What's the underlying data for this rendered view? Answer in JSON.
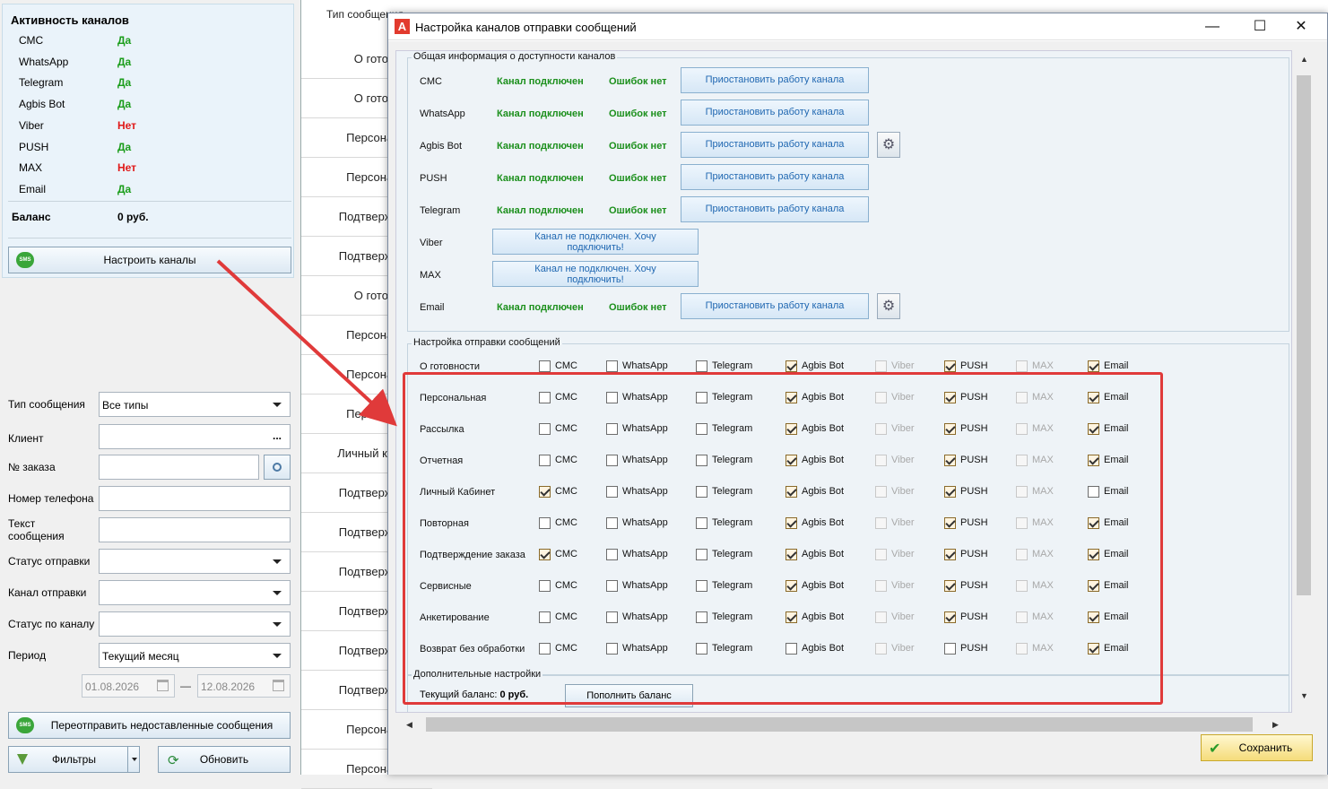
{
  "activity": {
    "title": "Активность каналов",
    "channels": [
      {
        "name": "СМС",
        "value": "Да",
        "status": "yes"
      },
      {
        "name": "WhatsApp",
        "value": "Да",
        "status": "yes"
      },
      {
        "name": "Telegram",
        "value": "Да",
        "status": "yes"
      },
      {
        "name": "Agbis Bot",
        "value": "Да",
        "status": "yes"
      },
      {
        "name": "Viber",
        "value": "Нет",
        "status": "no"
      },
      {
        "name": "PUSH",
        "value": "Да",
        "status": "yes"
      },
      {
        "name": "MAX",
        "value": "Нет",
        "status": "no"
      },
      {
        "name": "Email",
        "value": "Да",
        "status": "yes"
      }
    ],
    "balance_label": "Баланс",
    "balance_value": "0 руб.",
    "configure_button": "Настроить каналы",
    "sms_icon_text": "SMS"
  },
  "filters": {
    "message_type_label": "Тип сообщения",
    "message_type_value": "Все типы",
    "client_label": "Клиент",
    "client_dots": "...",
    "order_label": "№ заказа",
    "phone_label": "Номер телефона",
    "text_label_1": "Текст",
    "text_label_2": "сообщения",
    "send_status_label": "Статус отправки",
    "channel_label": "Канал отправки",
    "channel_status_label": "Статус по каналу",
    "period_label": "Период",
    "period_value": "Текущий месяц",
    "date_from": "01.08.2026",
    "date_dash": "—",
    "date_to": "12.08.2026",
    "resend_button": "Переотправить недоставленные сообщения",
    "filters_button": "Фильтры",
    "refresh_button": "Обновить"
  },
  "grid": {
    "header": "Тип сообщения",
    "rows": [
      "О готовности",
      "О готовности",
      "Персональная",
      "Персональная",
      "Подтверждение",
      "Подтверждение",
      "О готовности",
      "Персональная",
      "Персональная",
      "Персональная",
      "Личный кабинет",
      "Подтверждение",
      "Подтверждение",
      "Подтверждение",
      "Подтверждение",
      "Подтверждение",
      "Подтверждение",
      "Персональная",
      "Персональная"
    ]
  },
  "dialog": {
    "app_icon": "A",
    "title": "Настройка каналов отправки сообщений",
    "minimize": "—",
    "maximize": "☐",
    "close": "✕",
    "availability": {
      "title": "Общая информация о доступности каналов",
      "rows": [
        {
          "name": "СМС",
          "connected": true,
          "status": "Канал подключен",
          "errors": "Ошибок нет",
          "button": "Приостановить работу канала",
          "gear": false
        },
        {
          "name": "WhatsApp",
          "connected": true,
          "status": "Канал подключен",
          "errors": "Ошибок нет",
          "button": "Приостановить работу канала",
          "gear": false
        },
        {
          "name": "Agbis Bot",
          "connected": true,
          "status": "Канал подключен",
          "errors": "Ошибок нет",
          "button": "Приостановить работу канала",
          "gear": true
        },
        {
          "name": "PUSH",
          "connected": true,
          "status": "Канал подключен",
          "errors": "Ошибок нет",
          "button": "Приостановить работу канала",
          "gear": false
        },
        {
          "name": "Telegram",
          "connected": true,
          "status": "Канал подключен",
          "errors": "Ошибок нет",
          "button": "Приостановить работу канала",
          "gear": false
        },
        {
          "name": "Viber",
          "connected": false,
          "button1": "Канал не подключен. Хочу",
          "button2": "подключить!",
          "gear": false
        },
        {
          "name": "MAX",
          "connected": false,
          "button1": "Канал не подключен. Хочу",
          "button2": "подключить!",
          "gear": false
        },
        {
          "name": "Email",
          "connected": true,
          "status": "Канал подключен",
          "errors": "Ошибок нет",
          "button": "Приостановить работу канала",
          "gear": true
        }
      ]
    },
    "sending": {
      "title": "Настройка отправки сообщений",
      "channels": [
        "СМС",
        "WhatsApp",
        "Telegram",
        "Agbis Bot",
        "Viber",
        "PUSH",
        "MAX",
        "Email"
      ],
      "disabled_channels": [
        "Viber",
        "MAX"
      ],
      "rows": [
        {
          "type": "О готовности",
          "checked": [
            false,
            false,
            false,
            true,
            false,
            true,
            false,
            true
          ]
        },
        {
          "type": "Персональная",
          "checked": [
            false,
            false,
            false,
            true,
            false,
            true,
            false,
            true
          ]
        },
        {
          "type": "Рассылка",
          "checked": [
            false,
            false,
            false,
            true,
            false,
            true,
            false,
            true
          ]
        },
        {
          "type": "Отчетная",
          "checked": [
            false,
            false,
            false,
            true,
            false,
            true,
            false,
            true
          ]
        },
        {
          "type": "Личный Кабинет",
          "checked": [
            true,
            false,
            false,
            true,
            false,
            true,
            false,
            false
          ]
        },
        {
          "type": "Повторная",
          "checked": [
            false,
            false,
            false,
            true,
            false,
            true,
            false,
            true
          ]
        },
        {
          "type": "Подтверждение заказа",
          "checked": [
            true,
            false,
            false,
            true,
            false,
            true,
            false,
            true
          ]
        },
        {
          "type": "Сервисные",
          "checked": [
            false,
            false,
            false,
            true,
            false,
            true,
            false,
            true
          ]
        },
        {
          "type": "Анкетирование",
          "checked": [
            false,
            false,
            false,
            true,
            false,
            true,
            false,
            true
          ]
        },
        {
          "type": "Возврат без обработки",
          "checked": [
            false,
            false,
            false,
            false,
            false,
            false,
            false,
            true
          ]
        }
      ]
    },
    "extra": {
      "title": "Дополнительные настройки",
      "balance_label": "Текущий баланс:",
      "balance_value": "0 руб.",
      "topup_button": "Пополнить баланс"
    },
    "save_button": "Сохранить",
    "scroll_up": "▲",
    "scroll_down": "▼",
    "scroll_left": "◀",
    "scroll_right": "▶"
  },
  "colors": {
    "yes": "#1b9d1b",
    "no": "#e01919",
    "highlight": "#e03a3a",
    "link": "#1f67b1"
  }
}
